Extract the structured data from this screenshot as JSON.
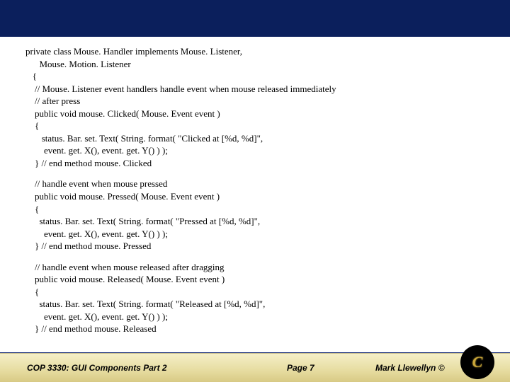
{
  "code": {
    "l1": "private class Mouse. Handler implements Mouse. Listener,",
    "l2": "      Mouse. Motion. Listener",
    "l3": "   {",
    "l4": "    // Mouse. Listener event handlers handle event when mouse released immediately",
    "l5": "    // after press",
    "l6": "    public void mouse. Clicked( Mouse. Event event )",
    "l7": "    {",
    "l8": "       status. Bar. set. Text( String. format( \"Clicked at [%d, %d]\",",
    "l9": "        event. get. X(), event. get. Y() ) );",
    "l10": "    } // end method mouse. Clicked",
    "m1": "    // handle event when mouse pressed",
    "m2": "    public void mouse. Pressed( Mouse. Event event )",
    "m3": "    {",
    "m4": "      status. Bar. set. Text( String. format( \"Pressed at [%d, %d]\",",
    "m5": "        event. get. X(), event. get. Y() ) );",
    "m6": "    } // end method mouse. Pressed",
    "n1": "    // handle event when mouse released after dragging",
    "n2": "    public void mouse. Released( Mouse. Event event )",
    "n3": "    {",
    "n4": "      status. Bar. set. Text( String. format( \"Released at [%d, %d]\",",
    "n5": "        event. get. X(), event. get. Y() ) );",
    "n6": "    } // end method mouse. Released"
  },
  "footer": {
    "course": "COP 3330: GUI Components Part 2",
    "page": "Page 7",
    "author": "Mark Llewellyn ©"
  },
  "logo": {
    "glyph": "C"
  }
}
